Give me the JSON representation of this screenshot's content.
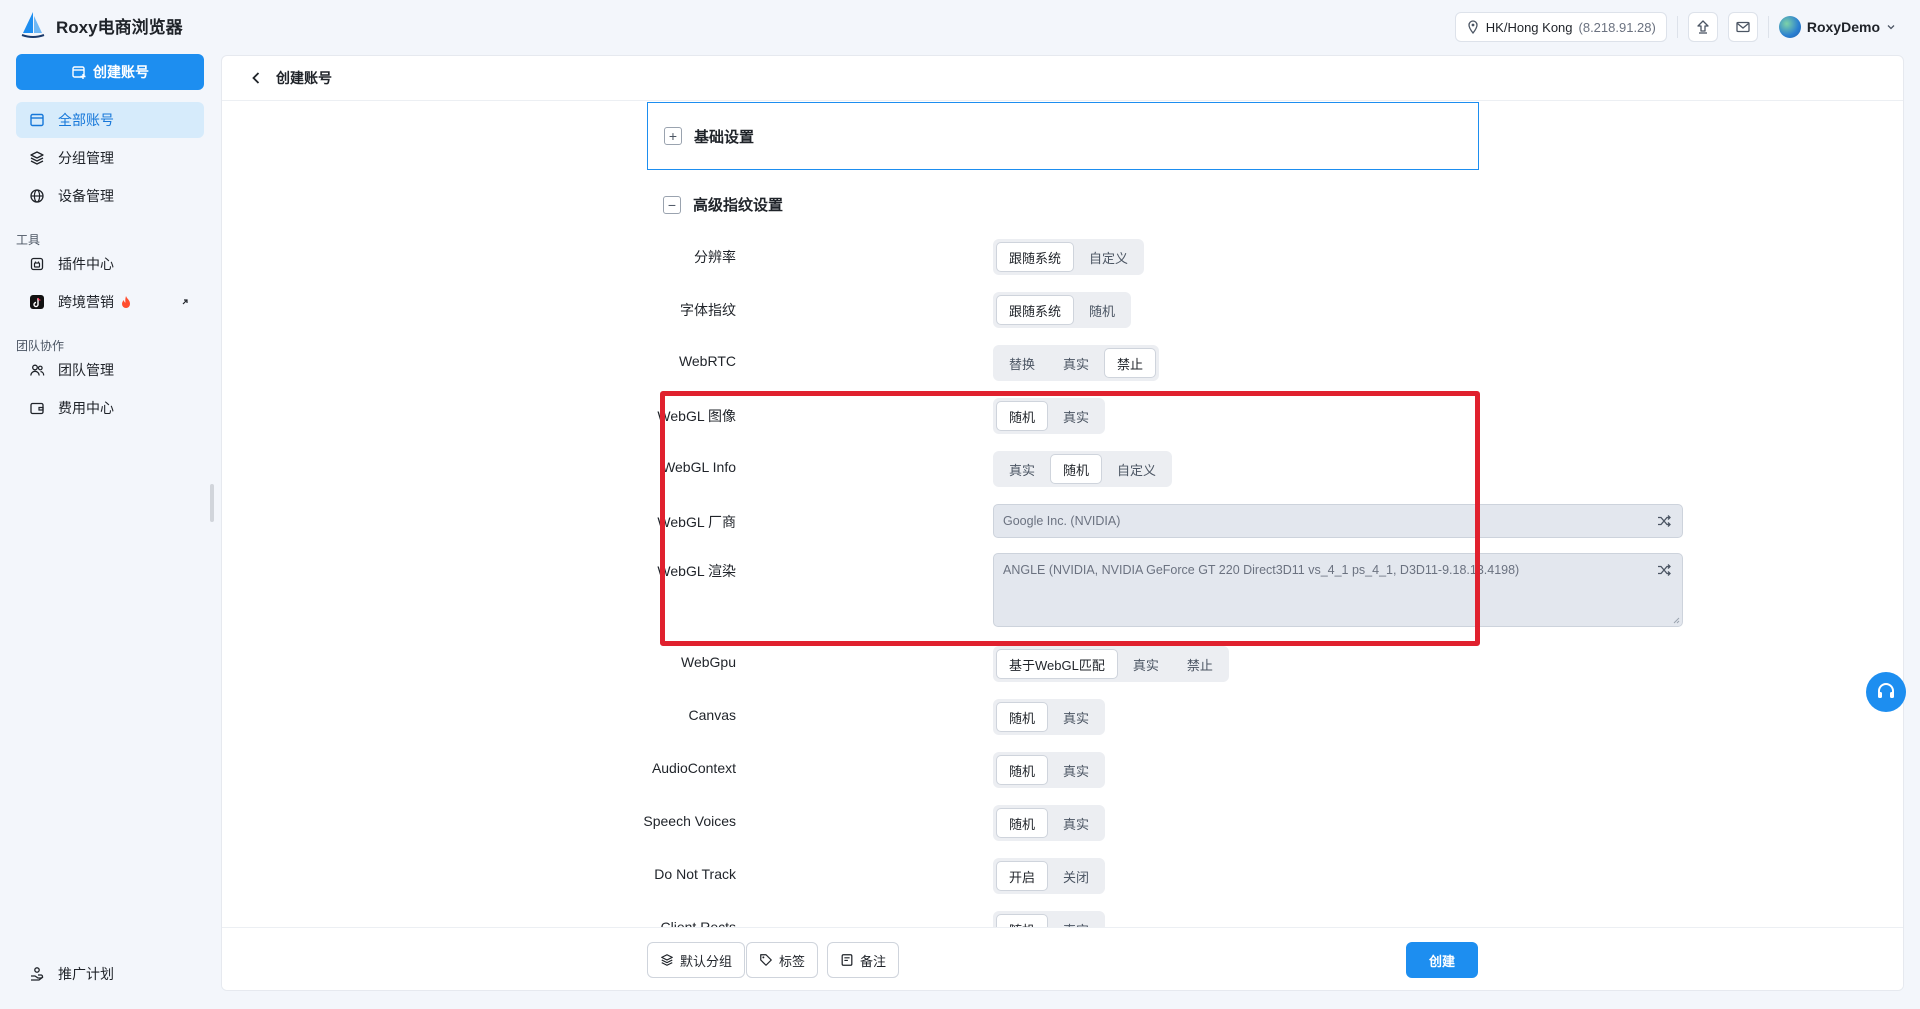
{
  "app": {
    "title": "Roxy电商浏览器"
  },
  "topbar": {
    "location": "HK/Hong Kong",
    "ip": "(8.218.91.28)",
    "user": "RoxyDemo"
  },
  "sidebar": {
    "create_button": "创建账号",
    "items": [
      {
        "label": "全部账号",
        "icon": "accounts-icon",
        "active": true
      },
      {
        "label": "分组管理",
        "icon": "layers-icon"
      },
      {
        "label": "设备管理",
        "icon": "globe-icon"
      }
    ],
    "tools_label": "工具",
    "tools": [
      {
        "label": "插件中心",
        "icon": "plugin-icon"
      },
      {
        "label": "跨境营销",
        "icon": "tiktok-icon"
      }
    ],
    "team_label": "团队协作",
    "team": [
      {
        "label": "团队管理",
        "icon": "team-icon"
      },
      {
        "label": "费用中心",
        "icon": "wallet-icon"
      }
    ],
    "promo": "推广计划"
  },
  "page": {
    "breadcrumb": "创建账号",
    "basic_section": "基础设置",
    "advanced_section": "高级指纹设置"
  },
  "settings": {
    "resolution": {
      "label": "分辨率",
      "options": [
        "跟随系统",
        "自定义"
      ],
      "selected": 0
    },
    "font": {
      "label": "字体指纹",
      "options": [
        "跟随系统",
        "随机"
      ],
      "selected": 0
    },
    "webrtc": {
      "label": "WebRTC",
      "options": [
        "替换",
        "真实",
        "禁止"
      ],
      "selected": 2
    },
    "webgl_image": {
      "label": "WebGL 图像",
      "options": [
        "随机",
        "真实"
      ],
      "selected": 0
    },
    "webgl_info": {
      "label": "WebGL Info",
      "options": [
        "真实",
        "随机",
        "自定义"
      ],
      "selected": 1
    },
    "webgl_vendor": {
      "label": "WebGL 厂商",
      "value": "Google Inc. (NVIDIA)"
    },
    "webgl_render": {
      "label": "WebGL 渲染",
      "value": "ANGLE (NVIDIA, NVIDIA GeForce GT 220  Direct3D11 vs_4_1 ps_4_1, D3D11-9.18.13.4198)"
    },
    "webgpu": {
      "label": "WebGpu",
      "options": [
        "基于WebGL匹配",
        "真实",
        "禁止"
      ],
      "selected": 0
    },
    "canvas": {
      "label": "Canvas",
      "options": [
        "随机",
        "真实"
      ],
      "selected": 0
    },
    "audio": {
      "label": "AudioContext",
      "options": [
        "随机",
        "真实"
      ],
      "selected": 0
    },
    "speech": {
      "label": "Speech Voices",
      "options": [
        "随机",
        "真实"
      ],
      "selected": 0
    },
    "dnt": {
      "label": "Do Not Track",
      "options": [
        "开启",
        "关闭"
      ],
      "selected": 0
    },
    "client_rects": {
      "label": "Client Rects",
      "options": [
        "随机",
        "真实"
      ],
      "selected": 0
    }
  },
  "footer": {
    "group_button": "默认分组",
    "tag_button": "标签",
    "note_button": "备注",
    "create_button": "创建"
  },
  "colors": {
    "accent": "#1d8ef0",
    "highlight": "#e0212e"
  }
}
